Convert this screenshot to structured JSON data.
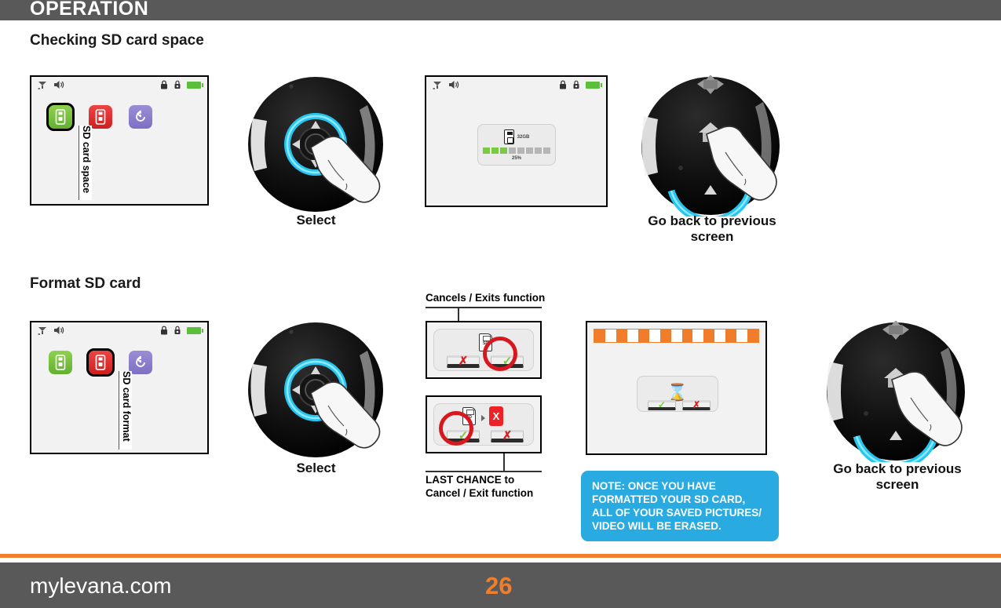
{
  "header": {
    "title": "OPERATION"
  },
  "sections": [
    {
      "heading": "Checking SD card space"
    },
    {
      "heading": "Format SD card"
    }
  ],
  "screens": {
    "sd_space_menu": {
      "status_icons": [
        "signal-icon",
        "speaker-icon",
        "lock-icon",
        "alarm-icon",
        "battery-icon"
      ],
      "menu_items": [
        {
          "name": "sd-card-space-icon",
          "color": "#7ac943",
          "selected": true
        },
        {
          "name": "sd-card-format-icon",
          "color": "#e02b2b",
          "selected": false
        },
        {
          "name": "reset-icon",
          "color": "#8878cc",
          "selected": false
        }
      ],
      "caption": "SD card space"
    },
    "sd_space_detail": {
      "capacity": "32GB",
      "percent": "25%",
      "segments_total": 8,
      "segments_filled": 3
    },
    "sd_format_menu": {
      "menu_items": [
        {
          "name": "sd-card-space-icon",
          "color": "#7ac943",
          "selected": false
        },
        {
          "name": "sd-card-format-icon",
          "color": "#e02b2b",
          "selected": true
        },
        {
          "name": "reset-icon",
          "color": "#8878cc",
          "selected": false
        }
      ],
      "caption": "SD card format"
    },
    "confirm_dialog_1": {
      "cancel_glyph": "✗",
      "confirm_glyph": "✓",
      "sd_label": "SD",
      "highlighted": "confirm-button"
    },
    "confirm_dialog_2": {
      "cancel_glyph": "✗",
      "confirm_glyph": "✓",
      "sd_label": "SD",
      "erase_glyph": "X",
      "highlighted": "confirm-button"
    },
    "formatting": {
      "hourglass_glyph": "⌛",
      "confirm_glyph": "✓",
      "cancel_glyph": "✗",
      "progress_segments": 15,
      "progress_color": "#f07d2b"
    }
  },
  "annotations": {
    "cancels_exits": "Cancels / Exits function",
    "last_chance": "LAST CHANCE to\nCancel / Exit function"
  },
  "remotes": [
    {
      "name": "dpad-select-1",
      "caption": "Select",
      "button": "center-select-button"
    },
    {
      "name": "home-back-1",
      "caption": "Go back to\nprevious screen",
      "button": "home-button"
    },
    {
      "name": "dpad-select-2",
      "caption": "Select",
      "button": "center-select-button"
    },
    {
      "name": "home-back-2",
      "caption": "Go back to\nprevious screen",
      "button": "home-button"
    }
  ],
  "note": {
    "text": "NOTE: ONCE YOU HAVE\nFORMATTED YOUR SD CARD,\nALL OF YOUR SAVED PICTURES/\nVIDEO WILL BE ERASED.",
    "color": "#29abe2"
  },
  "footer": {
    "site": "mylevana.com",
    "page_number": "26",
    "accent_color": "#ef7f2e",
    "bar_color": "#595959"
  }
}
